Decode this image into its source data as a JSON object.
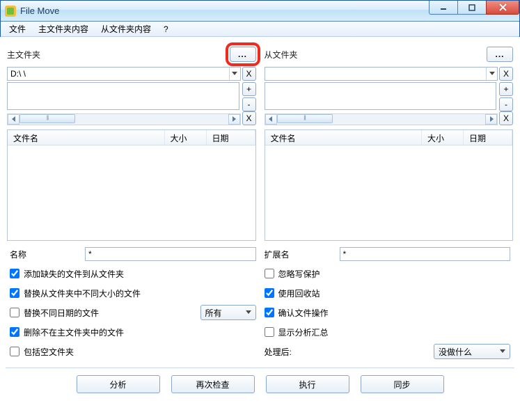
{
  "window": {
    "title": "File Move"
  },
  "menu": {
    "file": "文件",
    "master": "主文件夹内容",
    "slave": "从文件夹内容",
    "help": "?"
  },
  "master": {
    "label": "主文件夹",
    "browse": "...",
    "path": "D:\\           \\",
    "cols": {
      "name": "文件名",
      "size": "大小",
      "date": "日期"
    }
  },
  "slave": {
    "label": "从文件夹",
    "browse": "...",
    "path": "",
    "cols": {
      "name": "文件名",
      "size": "大小",
      "date": "日期"
    }
  },
  "buttons": {
    "x": "X",
    "plus": "+",
    "minus": "-"
  },
  "filters": {
    "name_label": "名称",
    "name_value": "*",
    "ext_label": "扩展名",
    "ext_value": "*"
  },
  "opts_left": {
    "add_missing": "添加缺失的文件到从文件夹",
    "replace_size": "替换从文件夹中不同大小的文件",
    "replace_date": "替换不同日期的文件",
    "delete_not_in_master": "删除不在主文件夹中的文件",
    "include_empty": "包括空文件夹",
    "date_mode": "所有"
  },
  "opts_right": {
    "ignore_wp": "忽略写保护",
    "use_recycle": "使用回收站",
    "confirm_ops": "确认文件操作",
    "show_summary": "显示分析汇总",
    "after_label": "处理后:",
    "after_value": "没做什么"
  },
  "actions": {
    "analyze": "分析",
    "recheck": "再次检查",
    "execute": "执行",
    "sync": "同步"
  },
  "checks": {
    "add_missing": true,
    "replace_size": true,
    "replace_date": false,
    "delete_not_in_master": true,
    "include_empty": false,
    "ignore_wp": false,
    "use_recycle": true,
    "confirm_ops": true,
    "show_summary": false
  }
}
